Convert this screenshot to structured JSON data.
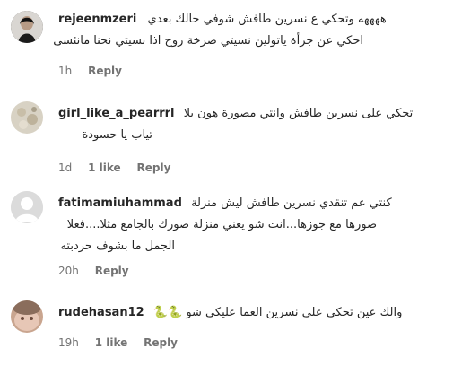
{
  "comments": [
    {
      "username": "rejeenmzeri",
      "text_line1": "ههههه وتحكي ع نسرين طافش شوفي حالك بعدي",
      "text_line2": "احكي عن جرأة ياتولين نسيتي صرخة روح اذا نسيتي نحنا مانئسى",
      "time": "1h",
      "likes": "",
      "reply": "Reply"
    },
    {
      "username": "girl_like_a_pearrrl",
      "text_line1": "تحكي على نسرين طافش وانتي مصورة هون بلا",
      "text_line2": "تياب يا حسودة",
      "time": "1d",
      "likes": "1 like",
      "reply": "Reply"
    },
    {
      "username": "fatimamiuhammad",
      "text_line1": "كنتي عم تنقدي نسرين طافش ليش منزلة",
      "text_line2": "صورها مع جوزها...انت شو يعني منزلة صورك بالجامع مثلا....فعلا",
      "text_line3": "الجمل ما بشوف حردبته",
      "time": "20h",
      "likes": "",
      "reply": "Reply"
    },
    {
      "username": "rudehasan12",
      "text_line1": "والك عين تحكي على نسرين العما عليكي شو 🐍🐍",
      "time": "19h",
      "likes": "1 like",
      "reply": "Reply"
    }
  ],
  "colors": {
    "text": "#262626",
    "meta": "#737373"
  }
}
